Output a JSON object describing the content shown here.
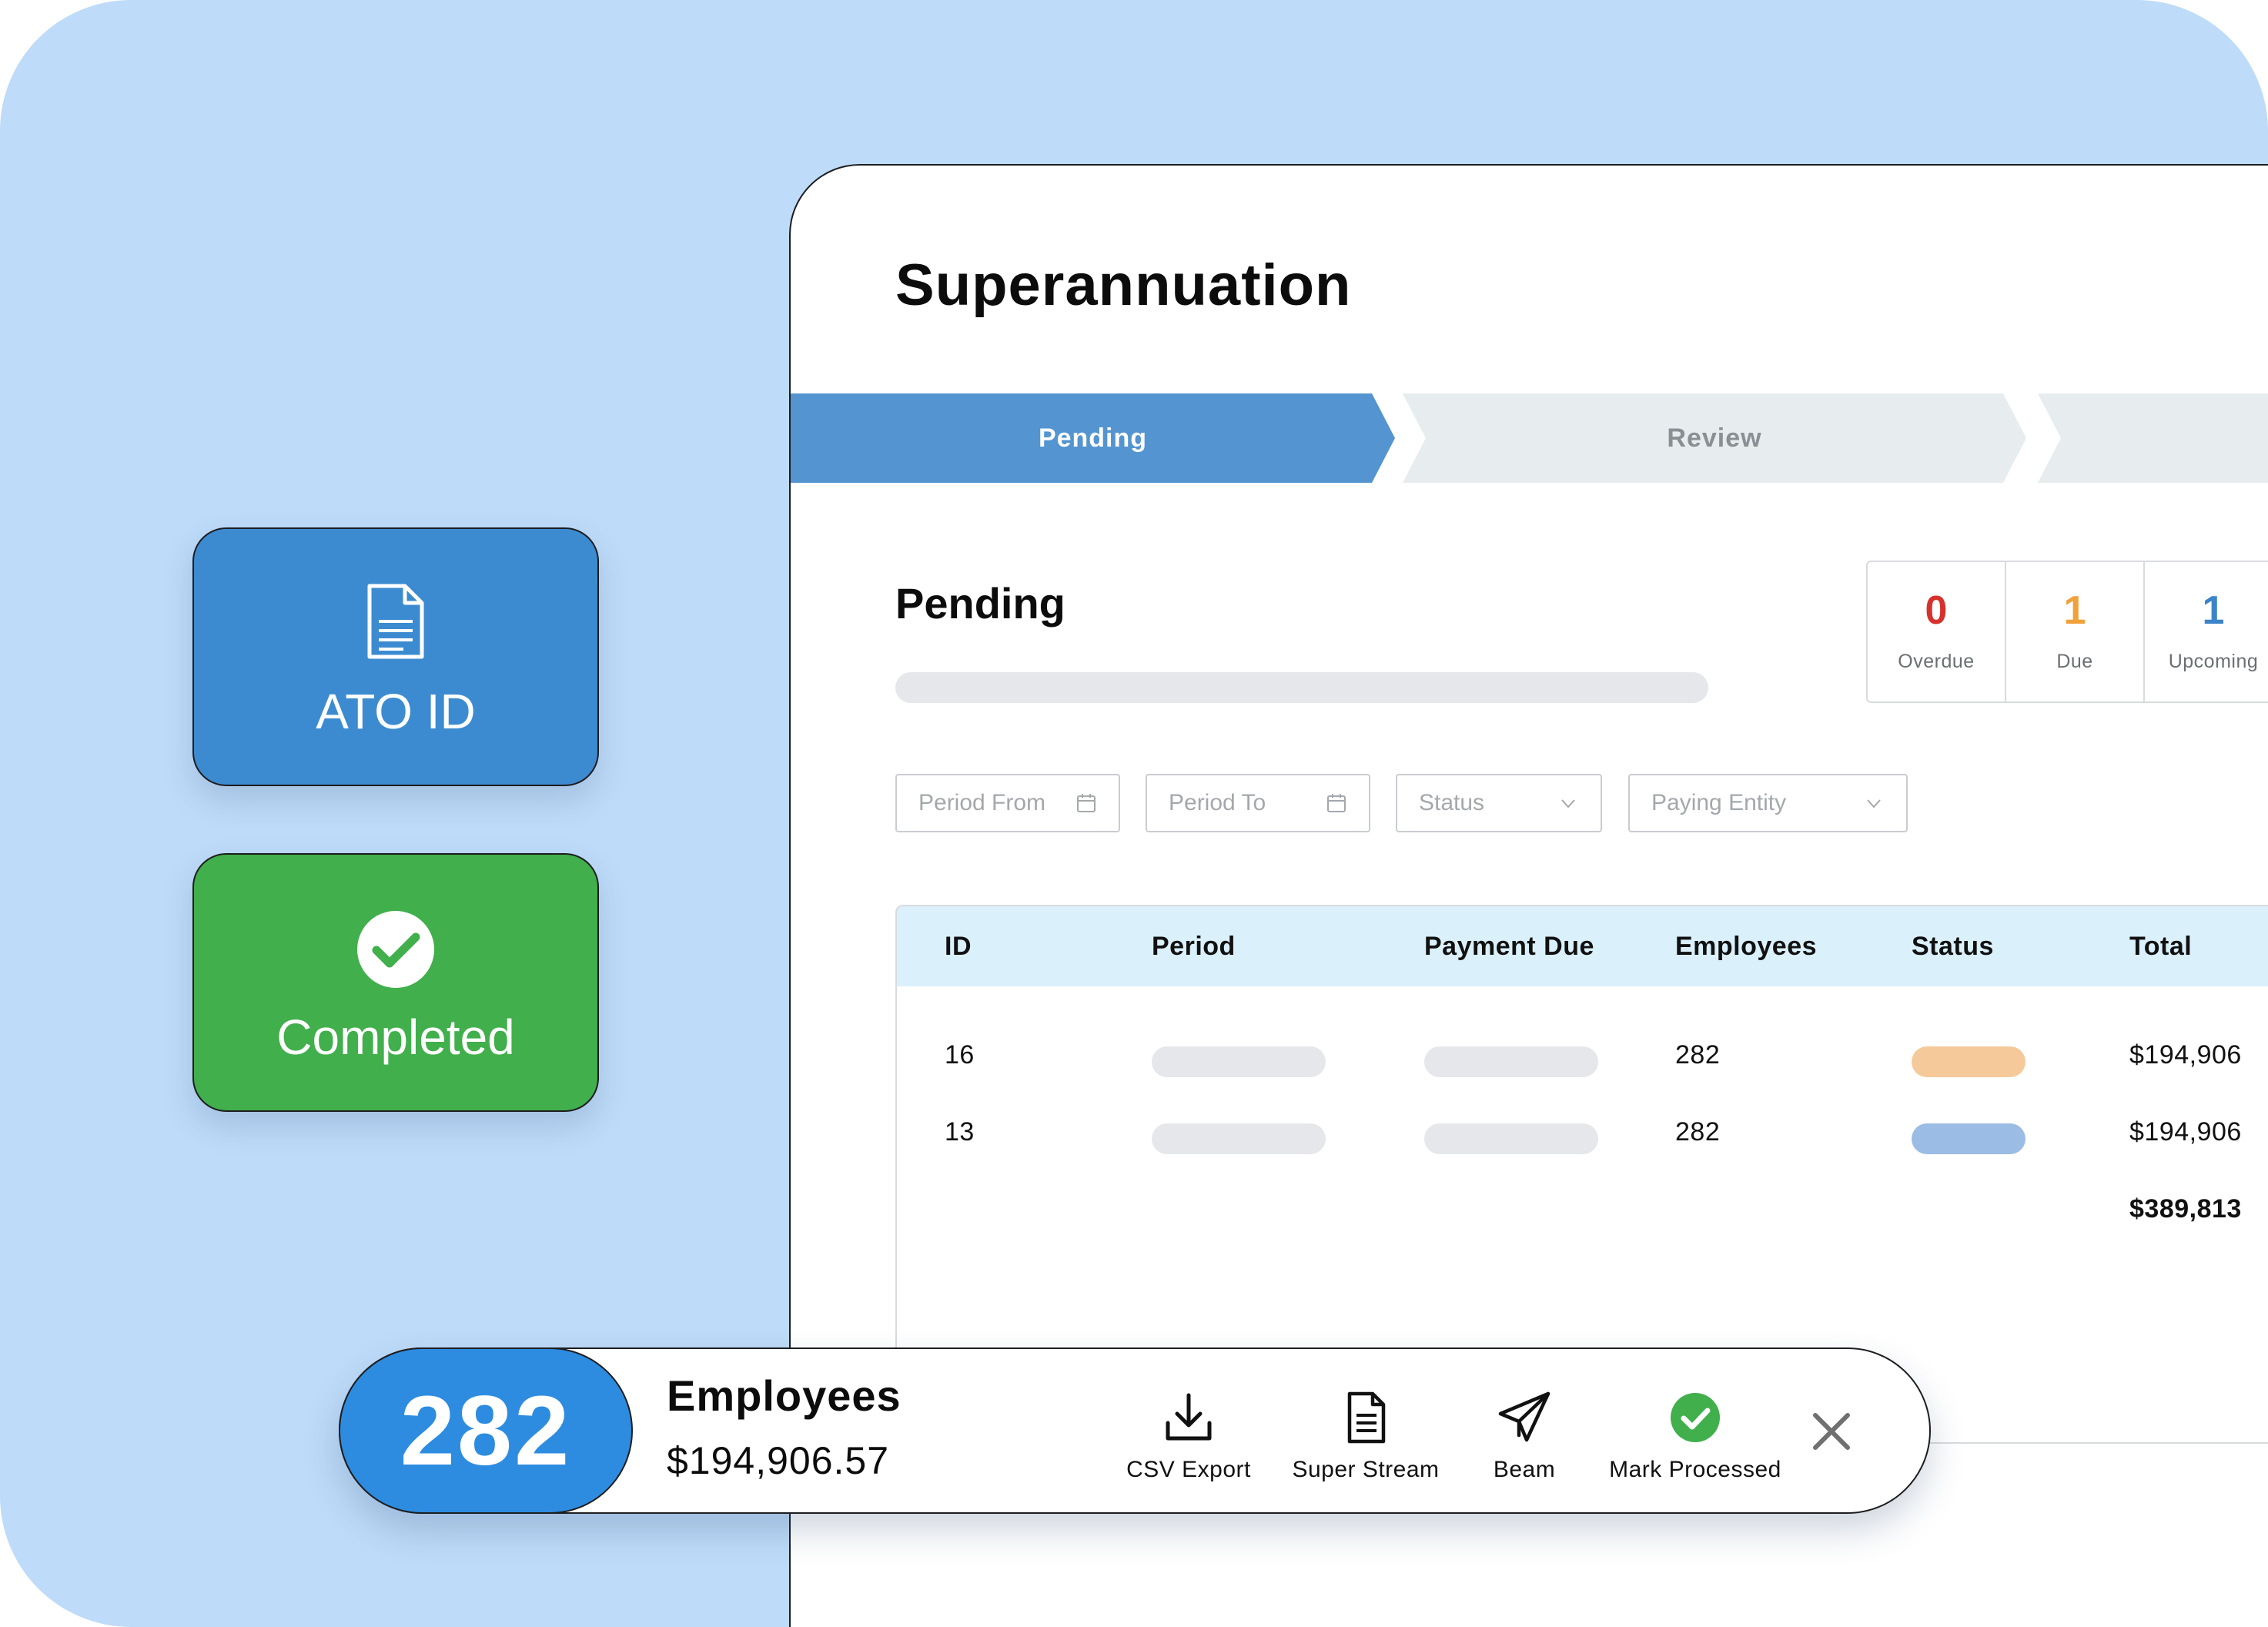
{
  "app": {
    "title": "Superannuation",
    "steps": [
      {
        "label": "Pending",
        "active": true
      },
      {
        "label": "Review",
        "active": false
      },
      {
        "label": "",
        "active": false
      }
    ]
  },
  "section": {
    "title": "Pending"
  },
  "counters": [
    {
      "value": "0",
      "label": "Overdue",
      "color": "#d6312d"
    },
    {
      "value": "1",
      "label": "Due",
      "color": "#f0a13b"
    },
    {
      "value": "1",
      "label": "Upcoming",
      "color": "#3b84c9"
    }
  ],
  "filters": {
    "period_from": "Period From",
    "period_to": "Period To",
    "status": "Status",
    "paying_entity": "Paying Entity"
  },
  "table": {
    "columns": [
      "ID",
      "Period",
      "Payment Due",
      "Employees",
      "Status",
      "Total"
    ],
    "rows": [
      {
        "id": "16",
        "employees": "282",
        "status_color": "#f5c99a",
        "total": "$194,906"
      },
      {
        "id": "13",
        "employees": "282",
        "status_color": "#9bbce4",
        "total": "$194,906"
      }
    ],
    "grand_total": "$389,813"
  },
  "cards": {
    "ato": {
      "label": "ATO ID",
      "icon": "document-icon",
      "color": "#3c8bd0"
    },
    "completed": {
      "label": "Completed",
      "icon": "check-circle-icon",
      "color": "#41af4c"
    }
  },
  "action_bar": {
    "count": "282",
    "title": "Employees",
    "amount": "$194,906.57",
    "actions": [
      {
        "label": "CSV Export",
        "icon": "download-icon"
      },
      {
        "label": "Super Stream",
        "icon": "document-icon"
      },
      {
        "label": "Beam",
        "icon": "paper-plane-icon"
      },
      {
        "label": "Mark Processed",
        "icon": "check-circle-icon"
      }
    ],
    "close_icon": "close-icon"
  }
}
